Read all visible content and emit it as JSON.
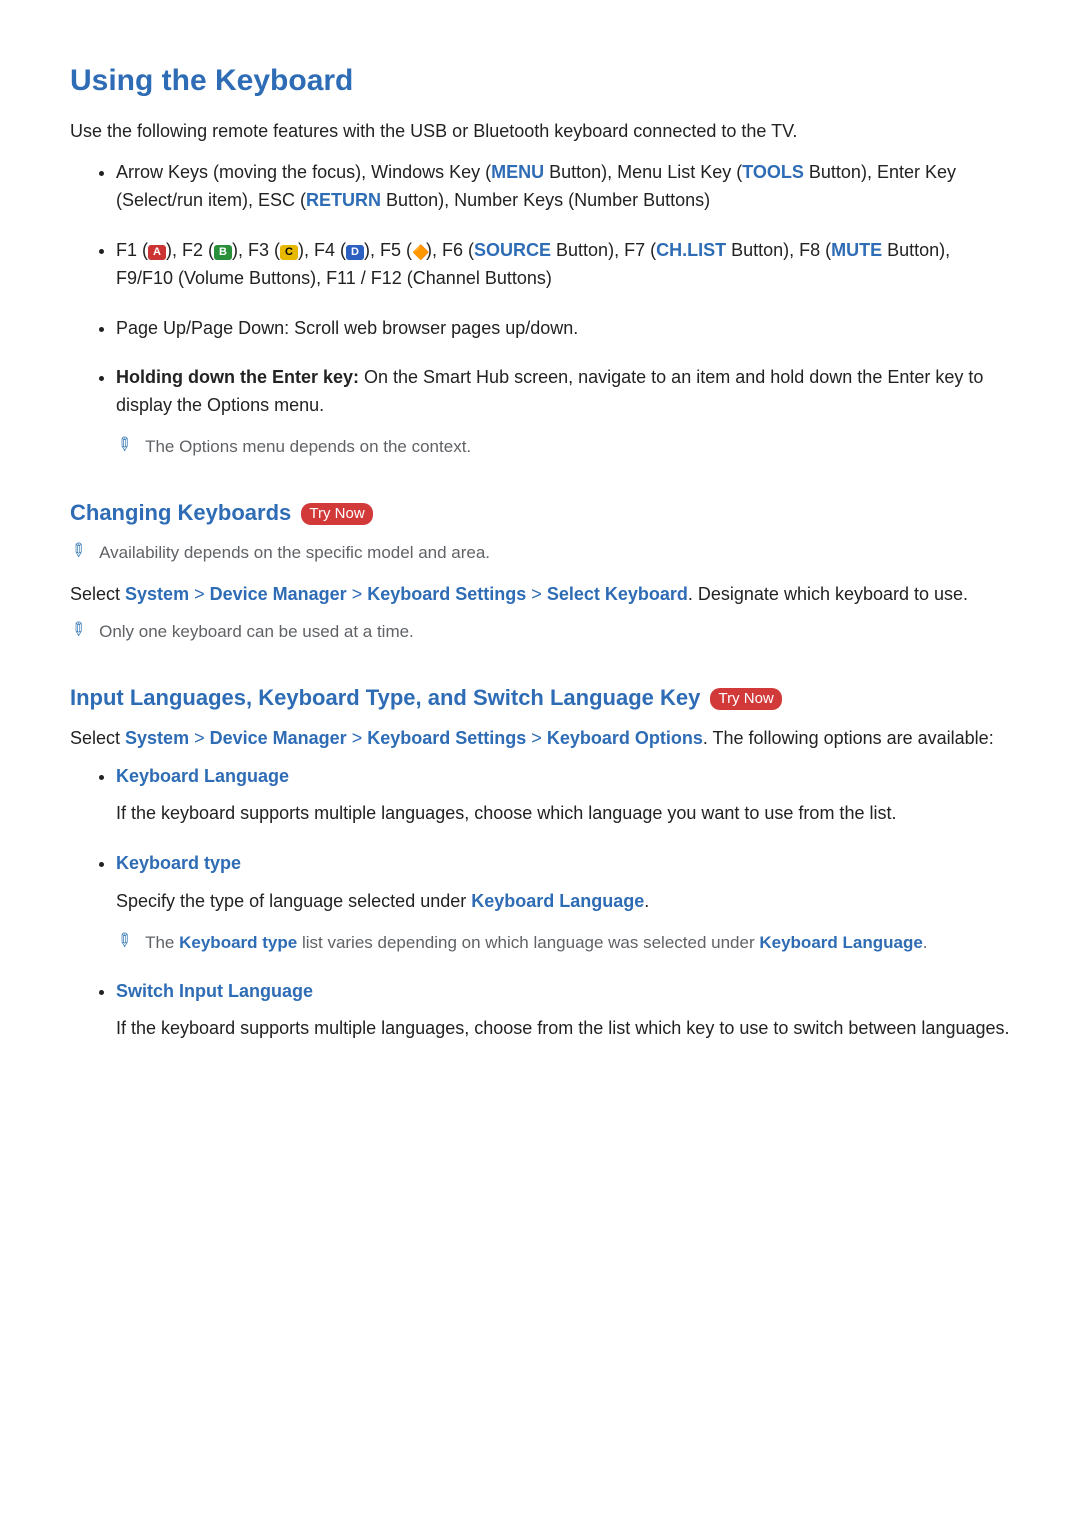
{
  "title": "Using the Keyboard",
  "intro": "Use the following remote features with the USB or Bluetooth keyboard connected to the TV.",
  "bullets": {
    "b1_pre": "Arrow Keys (moving the focus), Windows Key (",
    "b1_menu": "MENU",
    "b1_mid1": " Button), Menu List Key (",
    "b1_tools": "TOOLS",
    "b1_mid2": " Button), Enter Key (Select/run item), ESC (",
    "b1_return": "RETURN",
    "b1_end": " Button), Number Keys (Number Buttons)",
    "b2_f1": "F1 (",
    "b2_f2": "), F2 (",
    "b2_f3": "), F3 (",
    "b2_f4": "), F4 (",
    "b2_f5": "), F5 (",
    "b2_f6": "), F6 (",
    "b2_source": "SOURCE",
    "b2_f7": " Button), F7 (",
    "b2_chlist": "CH.LIST",
    "b2_f8": " Button), F8 (",
    "b2_mute": "MUTE",
    "b2_end": " Button), F9/F10 (Volume Buttons), F11 / F12 (Channel Buttons)",
    "b3": "Page Up/Page Down: Scroll web browser pages up/down.",
    "b4_bold": "Holding down the Enter key:",
    "b4_rest": " On the Smart Hub screen, navigate to an item and hold down the Enter key to display the Options menu.",
    "b4_note": "The Options menu depends on the context."
  },
  "badges": {
    "a": "A",
    "b": "B",
    "c": "C",
    "d": "D"
  },
  "section2": {
    "title": "Changing Keyboards",
    "try_now": "Try Now",
    "note1": "Availability depends on the specific model and area.",
    "path_pre": "Select ",
    "p_system": "System",
    "p_dm": "Device Manager",
    "p_ks": "Keyboard Settings",
    "p_sk": "Select Keyboard",
    "path_post": ". Designate which keyboard to use.",
    "note2": "Only one keyboard can be used at a time."
  },
  "section3": {
    "title": "Input Languages, Keyboard Type, and Switch Language Key",
    "try_now": "Try Now",
    "path_pre": "Select ",
    "p_system": "System",
    "p_dm": "Device Manager",
    "p_ks": "Keyboard Settings",
    "p_ko": "Keyboard Options",
    "path_post": ". The following options are available:",
    "items": {
      "i1_title": "Keyboard Language",
      "i1_body": "If the keyboard supports multiple languages, choose which language you want to use from the list.",
      "i2_title": "Keyboard type",
      "i2_body_pre": "Specify the type of language selected under ",
      "i2_body_link": "Keyboard Language",
      "i2_body_post": ".",
      "i2_note_pre": "The ",
      "i2_note_t1": "Keyboard type",
      "i2_note_mid": " list varies depending on which language was selected under ",
      "i2_note_t2": "Keyboard Language",
      "i2_note_post": ".",
      "i3_title": "Switch Input Language",
      "i3_body": "If the keyboard supports multiple languages, choose from the list which key to use to switch between languages."
    }
  },
  "glyphs": {
    "gt": ">"
  }
}
